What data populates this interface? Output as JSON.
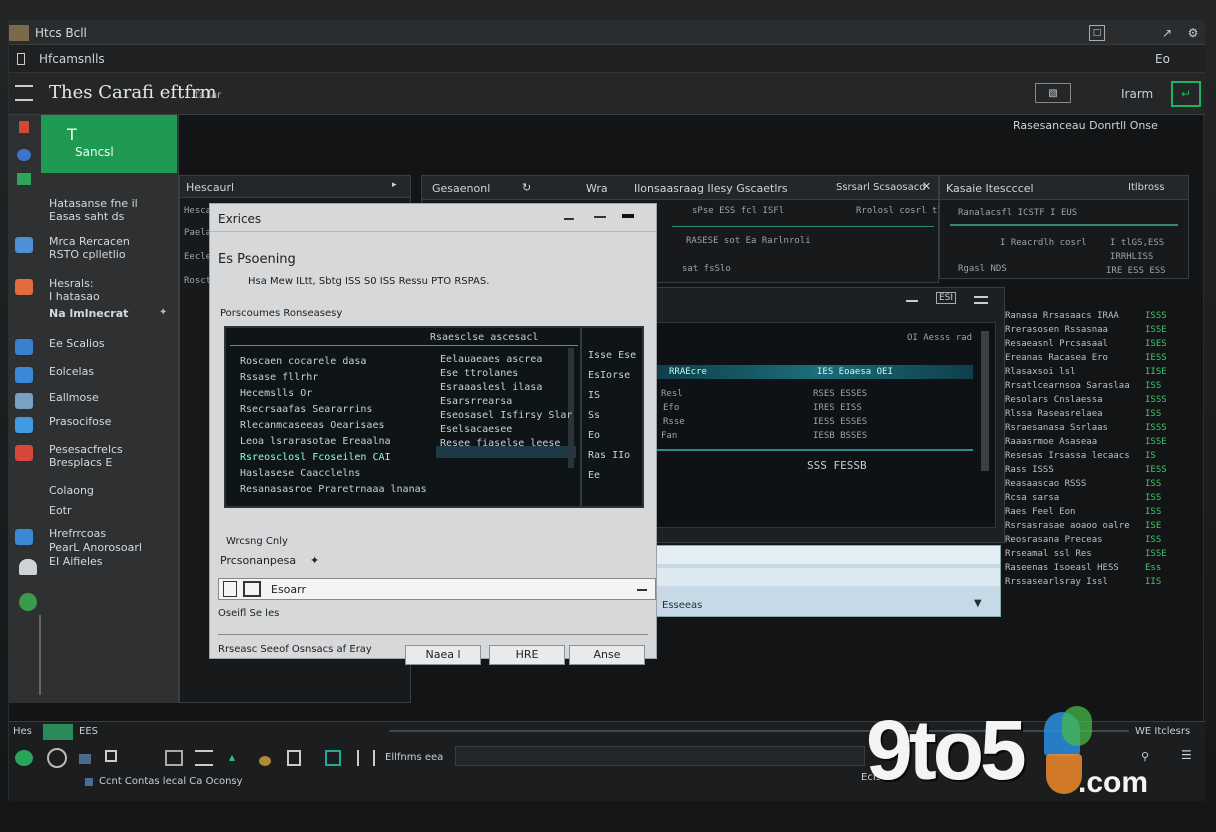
{
  "window": {
    "title": "Htcs  Bcll"
  },
  "menubar": {
    "left": "Hfcamsnlls",
    "right": "Eo"
  },
  "toolbar": {
    "app_title": "Thes Carafi  eftfrm",
    "app_sub": "ta lar",
    "right_label": "Irarm"
  },
  "sidebar": {
    "header": {
      "code": "T",
      "label": "Sancsl"
    },
    "items": [
      {
        "label": "Hatasanse fne il\nEasas saht  ds",
        "icon": "none",
        "color": ""
      },
      {
        "label": "Mrca Rercacen\nRSTO cplletlio",
        "icon": "shield-icon",
        "color": "#4f8fd6"
      },
      {
        "label": "Hesrals:\nI hatasao",
        "icon": "photo-icon",
        "color": "#e26b3b"
      },
      {
        "label": "Na lmlnecrat",
        "icon": "pin-icon",
        "color": "#777"
      },
      {
        "label": "Ee Scalios",
        "icon": "folder-icon",
        "color": "#3a7fd0"
      },
      {
        "label": "Eolcelas",
        "icon": "mail-icon",
        "color": "#3b88d8"
      },
      {
        "label": "Eallmose",
        "icon": "window-icon",
        "color": "#7aa0c4"
      },
      {
        "label": "Prasocifose",
        "icon": "monitor-icon",
        "color": "#3f9ae0"
      },
      {
        "label": "Pesesacfrelcs\nBresplacs E",
        "icon": "store-icon",
        "color": "#d9463b"
      },
      {
        "label": "Colaong\nEotr",
        "icon": "none",
        "color": ""
      },
      {
        "label": "Hrefrrcoas\nPearL Anorosoarl\nEI Aifieles",
        "icon": "doc-icon",
        "color": "#3b8ad8"
      },
      {
        "label": "",
        "icon": "cloud-icon",
        "color": "#cfd3d6"
      },
      {
        "label": "",
        "icon": "globe-icon",
        "color": "#3a9b4a"
      }
    ]
  },
  "left_panel": {
    "title": "Hescaurl",
    "rows": [
      "Hescanre ltoras sa",
      "Paelapscaroet oxloe",
      "Eecle",
      "Rosct"
    ]
  },
  "top_panel": {
    "tab": "Gesaenonl",
    "headers": [
      "Wra",
      "Ilonsaasraag  Ilesy Gscaetlrs",
      "Ssrsarl  Scsaosacd"
    ],
    "rows": [
      "sPse ESS fcl  ISFl",
      "RASESE sot Ea Rarlnroli",
      "Rrolosl cosrl tlcrts",
      "sat fsSlo"
    ]
  },
  "top_right_panel": {
    "title": "Kasaie Itescccel",
    "right": "Itlbross",
    "rows": [
      "Ranalacsfl  ICSTF  I EUS",
      "I Reacrdlh cosrl",
      "Rgasl NDS"
    ],
    "values": [
      "I tlGS,ESS",
      "IRRHLISS",
      "IRE ESS ESS"
    ]
  },
  "header_right": {
    "label": "Rasesanceau   Donrtll  Onse"
  },
  "dialog": {
    "title": "Exrices",
    "heading": "Es Psoening",
    "desc": "Hsa Mew ILtt, Sbtg ISS S0 ISS Ressu PTO RSPAS.",
    "section": "Porscoumes  Ronseasesy",
    "term_header": "Rsaesclse ascesacl",
    "term_left": [
      "Roscaen cocarele  dasa",
      "Rssase fllrhr",
      "Hecemslls  Or",
      "Rsecrsaafas Seararrins",
      "Rlecanmcaseeas Oearisaes",
      "Leoa lsrarasotae Ereaalna",
      "Rsreosclosl Fcoseilen  CAI",
      "Haslasese  Caacclelns",
      "Resanasasroe  Praretrnaaa lnanas"
    ],
    "term_mid": [
      "Eelauaeaes ascrea",
      "Ese ttrolanes",
      "Esraaaslesl ilasa",
      "Esarsrrearsa",
      "Eseosasel Isfirsy Slar",
      "Eselsacaesee",
      "Resee fiaselse leese"
    ],
    "term_right": [
      "Isse Ese",
      "EsIorse",
      "IS",
      "Ss",
      "Eo",
      "Ras IIo",
      "Ee"
    ],
    "note": "Wrcsng Cnly",
    "field_label": "Prcsonanpesa",
    "field_value": "Esoarr",
    "status": "Oseifl Se les",
    "footer": "Rrseasc Seeof  Osnsacs af Eray",
    "buttons": [
      "Naea l",
      "HRE",
      "Anse"
    ]
  },
  "media_panel": {
    "badge": "ESI",
    "sub": "OI  Aesss rad",
    "rows": [
      "Resl",
      "Efo",
      "Rsse",
      "Fan"
    ],
    "vals": [
      "RSES  ESSES",
      "IRES  EISS",
      "IESS ESSES",
      "IESB  BSSES"
    ],
    "bar_left": "RRAEcre",
    "bar_mid": "IES  Eoaesa  OEI",
    "foot": "SSS FESSB",
    "tray": "Esseeas"
  },
  "right_list": {
    "rows": [
      "Ranasa  Rrsasaacs IRAA",
      "Rrerasosen  Rssasnaa",
      "Resaeasnl  Prcsasaal",
      "Ereanas Racasea Ero",
      "Rlasaxsoi lsl",
      "Rrsatlcearnsoa  Saraslaa",
      "Resolars Cnslaessa",
      "Rlssa  Raseasrelaea",
      "Rsraesanasa  Ssrlaas",
      "Raaasrmoe  Asaseaa",
      "Resesas  Irsassa lecaacs",
      "Rass  ISSS",
      "Reasaascao   RSSS",
      "Rcsa sarsa",
      "Raes Feel  Eon",
      "Rsrsasrasae aoaoo  oalre",
      "Reosrasana  Preceas",
      "Rrseamal ssl  Res",
      "Raseenas  Isoeasl HESS",
      "Rrssasearlsray  Issl"
    ],
    "vals": [
      "ISSS",
      "ISSE",
      "ISES",
      "IESS",
      "IISE",
      "ISS",
      "ISSS",
      "ISS",
      "ISSS",
      "ISSE",
      "IS",
      "IESS",
      "ISS",
      "ISS",
      "ISS",
      "ISE",
      "ISS",
      "ISSE",
      "Ess",
      "IIS"
    ]
  },
  "taskbar": {
    "top_left": "Hes",
    "top_mid": "EES",
    "top_right": "WE  Itclesrs",
    "app": "Ellfnms  eea",
    "status": "Ccnt  Contas lecal  Ca  Oconsy",
    "clock": "EcISM"
  },
  "watermark": {
    "text1": "9to5",
    "text2": ".com"
  }
}
